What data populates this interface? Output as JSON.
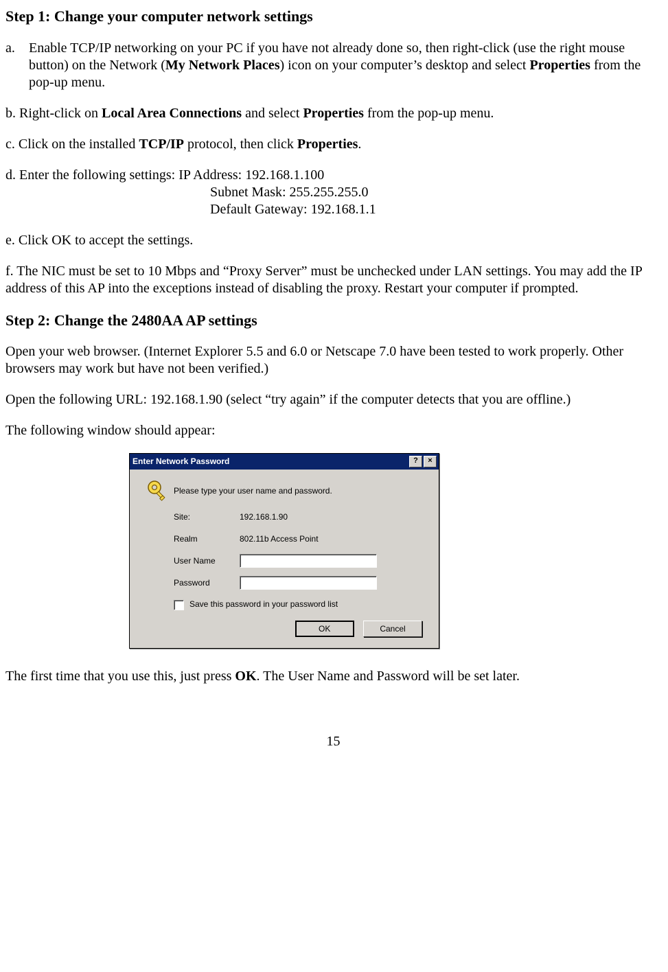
{
  "step1": {
    "heading": "Step 1:  Change your computer network settings",
    "a_pre": "a.",
    "a_text1": "Enable TCP/IP networking on your PC if you have not already done so, then right-click (use the right mouse button) on the Network (",
    "a_bold1": "My Network Places",
    "a_text2": ") icon on your computer’s desktop and select ",
    "a_bold2": "Properties",
    "a_text3": " from the pop-up menu.",
    "b_text1": "b.  Right-click on ",
    "b_bold1": "Local Area Connections",
    "b_text2": " and select ",
    "b_bold2": "Properties",
    "b_text3": " from the pop-up menu.",
    "c_text1": "c. Click on the installed ",
    "c_bold1": "TCP/IP",
    "c_text2": " protocol, then click ",
    "c_bold2": "Properties",
    "c_text3": ".",
    "d_line1": "d. Enter the following settings:  IP Address:   192.168.1.100",
    "d_line2": "Subnet Mask:  255.255.255.0",
    "d_line3": "Default Gateway:  192.168.1.1",
    "e": "e. Click OK to accept the settings.",
    "f": "f.  The NIC must be set to 10 Mbps and “Proxy Server” must be unchecked under LAN settings.  You may add the IP address of this AP into the exceptions instead of disabling the proxy.  Restart your computer if prompted."
  },
  "step2": {
    "heading": "Step 2:  Change the 2480AA AP settings",
    "p1": "Open your web browser.  (Internet Explorer 5.5 and 6.0 or Netscape 7.0 have been tested to work properly.  Other browsers may work but have not been verified.)",
    "p2": "Open the following URL:  192.168.1.90  (select “try again” if the computer detects that you are offline.)",
    "p3": "The following window should appear:",
    "after_pre": "The first time that you use this, just press ",
    "after_bold": "OK",
    "after_post": ".  The User Name and Password will be set later."
  },
  "dialog": {
    "title": "Enter Network Password",
    "help_glyph": "?",
    "close_glyph": "×",
    "prompt": "Please type your user name and password.",
    "site_label": "Site:",
    "site_value": "192.168.1.90",
    "realm_label": "Realm",
    "realm_value": "802.11b Access Point",
    "user_label": "User Name",
    "user_value": "",
    "pass_label": "Password",
    "pass_value": "",
    "save_label": "Save this password in your password list",
    "ok": "OK",
    "cancel": "Cancel"
  },
  "page_number": "15"
}
